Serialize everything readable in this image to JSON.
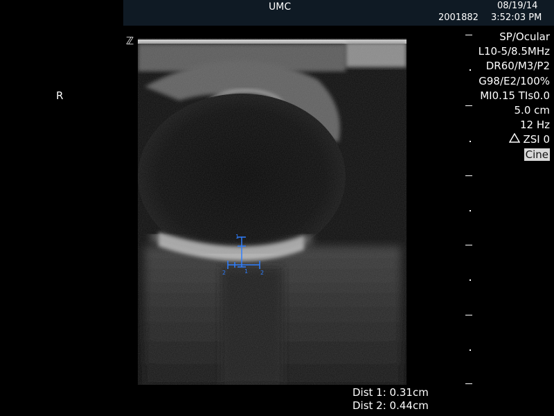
{
  "header": {
    "title": "UMC",
    "patient_id": "2001882",
    "date": "08/19/14",
    "time": "3:52:03 PM"
  },
  "image": {
    "orientation_marker": "R",
    "top_marker_icon": "z-orientation-icon",
    "caliper_labels": [
      "1",
      "1",
      "2",
      "2"
    ]
  },
  "parameters": {
    "preset": "SP/Ocular",
    "transducer": "L10-5/8.5MHz",
    "dynamic_range": "DR60/M3/P2",
    "gain": "G98/E2/100%",
    "mi_tis": "MI0.15  TIs0.0",
    "depth": "5.0 cm",
    "frame_rate": "12 Hz",
    "zsi": "ZSI 0",
    "zsi_icon": "triangle-focus-icon",
    "mode": "Cine"
  },
  "measurements": {
    "dist1": "Dist 1: 0.31cm",
    "dist2": "Dist 2: 0.44cm"
  },
  "colors": {
    "header_bg": "#0f1a24",
    "caliper": "#2f7fff",
    "cine_bg": "#d9d9d9"
  }
}
